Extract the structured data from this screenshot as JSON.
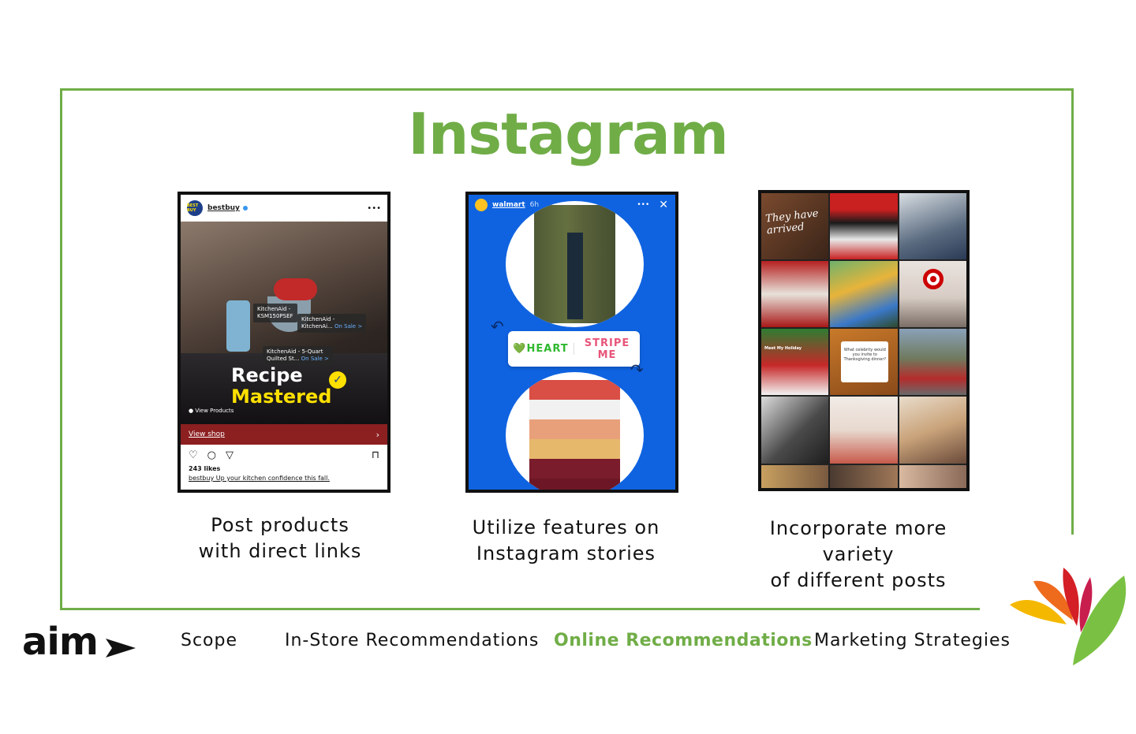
{
  "slide": {
    "title": "Instagram",
    "accent_color": "#70ad47"
  },
  "examples": [
    {
      "caption_line1": "Post products",
      "caption_line2": "with direct links",
      "post": {
        "avatar_text": "BEST BUY",
        "username": "bestbuy",
        "more_icon": "ellipsis-icon",
        "tag1_line1": "KitchenAid -",
        "tag1_line2": "KSM150PSEF",
        "tag2_line1": "KitchenAid -",
        "tag2_line2": "KitchenAi...",
        "tag2_sale": "On Sale >",
        "tag3_line1": "KitchenAid - 5-Quart",
        "tag3_line2": "Quilted St...",
        "tag3_sale": "On Sale >",
        "headline_line1": "Recipe",
        "headline_line2": "Mastered",
        "view_products": "View Products",
        "shop_label": "View shop",
        "likes": "243 likes",
        "caption": "bestbuy Up your kitchen confidence this fall."
      }
    },
    {
      "caption_line1": "Utilize features on",
      "caption_line2": "Instagram stories",
      "story": {
        "username": "walmart",
        "time": "6h",
        "more_icon": "ellipsis-icon",
        "close_icon": "close-icon",
        "option_1": "HEART",
        "option_2": "STRIPE ME"
      }
    },
    {
      "caption_line1": "Incorporate more variety",
      "caption_line2": "of different posts",
      "grid": {
        "cell_text_line1": "They have",
        "cell_text_line2": "arrived",
        "card_text": "What celebrity would you invite to Thanksgiving dinner?",
        "hello_label": "Meet My Holiday"
      }
    }
  ],
  "nav": {
    "logo": "aim",
    "items": [
      "Scope",
      "In-Store Recommendations",
      "Online Recommendations",
      "Marketing Strategies"
    ],
    "active": "Online Recommendations"
  }
}
